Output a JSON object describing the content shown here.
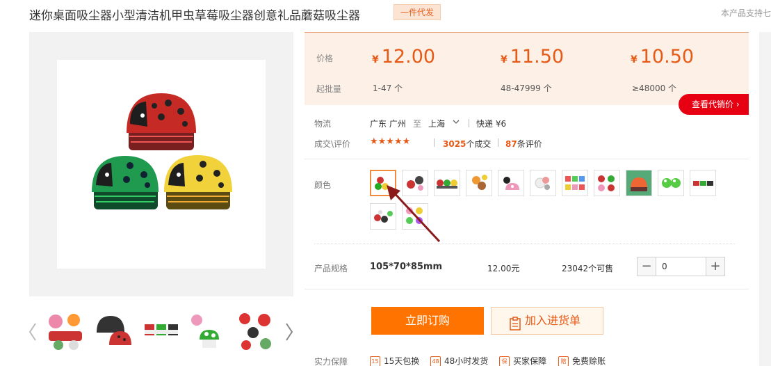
{
  "product": {
    "title": "迷你桌面吸尘器小型清洁机甲虫草莓吸尘器创意礼品蘑菇吸尘器",
    "badge": "一件代发",
    "support_note": "本产品支持七"
  },
  "price": {
    "price_label": "价格",
    "moq_label": "起批量",
    "currency": "¥",
    "tiers": [
      {
        "price": "12.00",
        "range": "1-47 个"
      },
      {
        "price": "11.50",
        "range": "48-47999 个"
      },
      {
        "price": "10.50",
        "range": "≥48000 个"
      }
    ],
    "distro_button": "查看代销价 ›"
  },
  "logistics": {
    "label": "物流",
    "from": "广东 广州",
    "to_word": "至",
    "to": "上海",
    "shipping": "快递 ¥6"
  },
  "trade": {
    "label": "成交\\评价",
    "rating": 5,
    "stars": "★★★★★",
    "deals_count": "3025",
    "deals_suffix": "个成交",
    "reviews_count": "87",
    "reviews_suffix": "条评价"
  },
  "color": {
    "label": "颜色",
    "selected_index": 0,
    "swatch_count": 13
  },
  "spec": {
    "label": "产品规格",
    "value": "105*70*85mm",
    "price": "12.00元",
    "stock": "23042个可售",
    "quantity": "0",
    "minus": "−",
    "plus": "+"
  },
  "actions": {
    "buy": "立即订购",
    "cart": "加入进货单"
  },
  "guarantee": {
    "label": "实力保障",
    "items": [
      {
        "icon": "15",
        "text": "15天包换"
      },
      {
        "icon": "48",
        "text": "48小时发货"
      },
      {
        "icon": "保",
        "text": "买家保障"
      },
      {
        "icon": "赔",
        "text": "免费赊账"
      }
    ]
  },
  "colors": {
    "accent": "#e65a17",
    "buy_button": "#ff7300",
    "distro_button": "#e60012",
    "price_bg": "#fdf0e7"
  }
}
